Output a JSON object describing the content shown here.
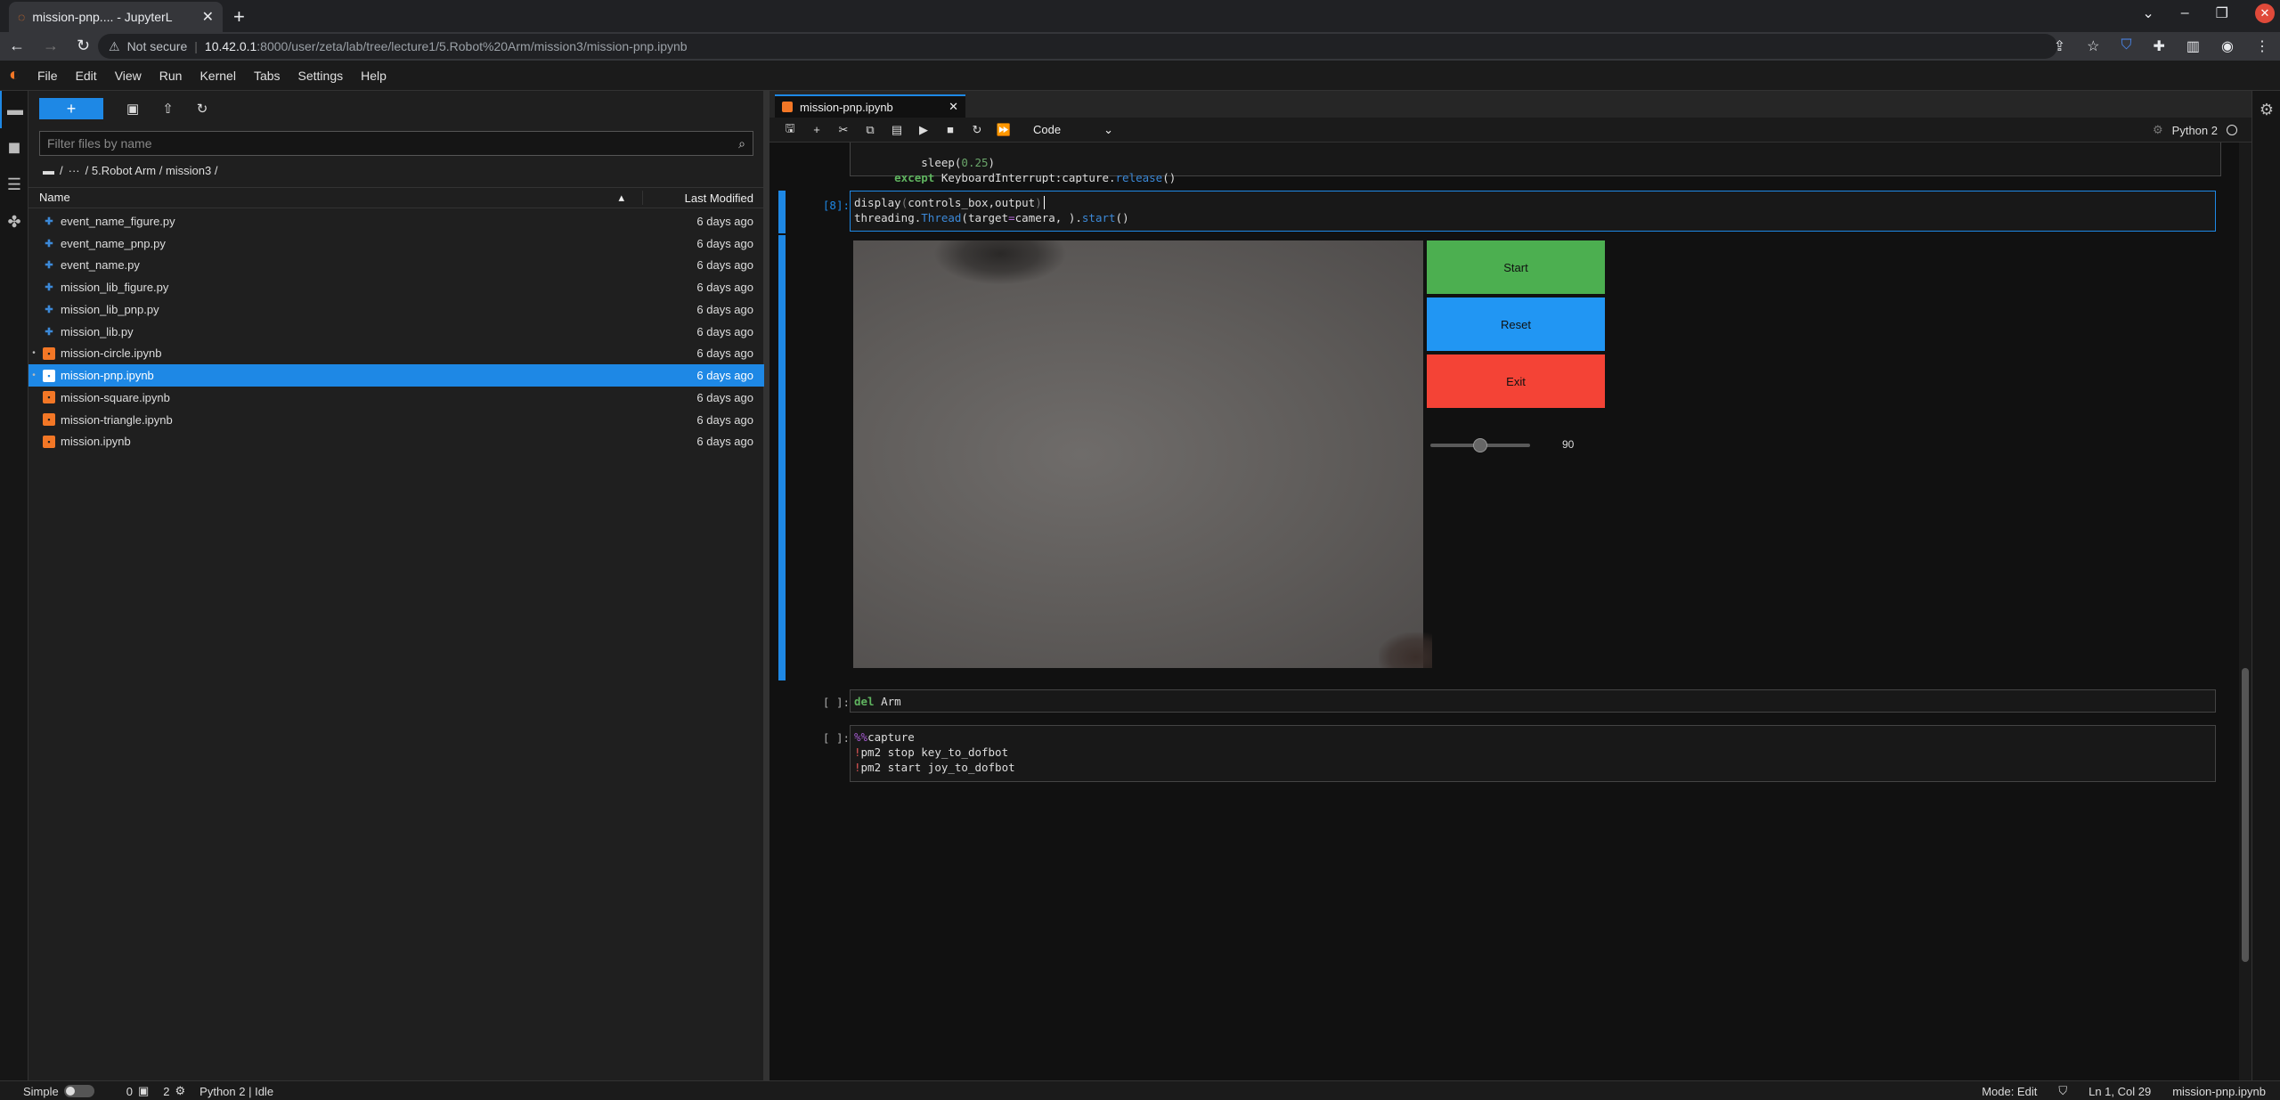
{
  "browser": {
    "tab_title": "mission-pnp.... - JupyterL",
    "url_security": "Not secure",
    "url_host": "10.42.0.1",
    "url_path": ":8000/user/zeta/lab/tree/lecture1/5.Robot%20Arm/mission3/mission-pnp.ipynb"
  },
  "menu": [
    "File",
    "Edit",
    "View",
    "Run",
    "Kernel",
    "Tabs",
    "Settings",
    "Help"
  ],
  "filebrowser": {
    "filter_placeholder": "Filter files by name",
    "breadcrumb_root": "/",
    "breadcrumb_ellipsis": "···",
    "breadcrumb_path": "/ 5.Robot Arm / mission3 /",
    "col_name": "Name",
    "col_modified": "Last Modified",
    "files": [
      {
        "name": "event_name_figure.py",
        "type": "py",
        "modified": "6 days ago",
        "running": false
      },
      {
        "name": "event_name_pnp.py",
        "type": "py",
        "modified": "6 days ago",
        "running": false
      },
      {
        "name": "event_name.py",
        "type": "py",
        "modified": "6 days ago",
        "running": false
      },
      {
        "name": "mission_lib_figure.py",
        "type": "py",
        "modified": "6 days ago",
        "running": false
      },
      {
        "name": "mission_lib_pnp.py",
        "type": "py",
        "modified": "6 days ago",
        "running": false
      },
      {
        "name": "mission_lib.py",
        "type": "py",
        "modified": "6 days ago",
        "running": false
      },
      {
        "name": "mission-circle.ipynb",
        "type": "nb",
        "modified": "6 days ago",
        "running": true
      },
      {
        "name": "mission-pnp.ipynb",
        "type": "nb",
        "modified": "6 days ago",
        "running": true,
        "selected": true
      },
      {
        "name": "mission-square.ipynb",
        "type": "nb",
        "modified": "6 days ago",
        "running": false
      },
      {
        "name": "mission-triangle.ipynb",
        "type": "nb",
        "modified": "6 days ago",
        "running": false
      },
      {
        "name": "mission.ipynb",
        "type": "nb",
        "modified": "6 days ago",
        "running": false
      }
    ]
  },
  "notebook": {
    "tab_name": "mission-pnp.ipynb",
    "cell_type": "Code",
    "kernel_name": "Python 2",
    "cells": {
      "top_line1_a": "sleep(",
      "top_line1_num": "0.25",
      "top_line1_b": ")",
      "top_line2_kw": "except",
      "top_line2_a": " KeyboardInterrupt:capture.",
      "top_line2_fn": "release",
      "top_line2_b": "()",
      "c8_prompt": "[8]:",
      "c8_l1_a": "display",
      "c8_l1_b": "(",
      "c8_l1_c": "controls_box,output",
      "c8_l1_d": ")",
      "c8_l2_a": "threading.",
      "c8_l2_fn": "Thread",
      "c8_l2_b": "(target",
      "c8_l2_op": "=",
      "c8_l2_c": "camera, ).",
      "c8_l2_fn2": "start",
      "c8_l2_d": "()",
      "del_prompt": "[ ]:",
      "del_kw": "del",
      "del_rest": " Arm",
      "cap_prompt": "[ ]:",
      "cap_l1_mg": "%%",
      "cap_l1_rest": "capture",
      "cap_l2_sh": "!",
      "cap_l2_rest": "pm2 stop key_to_dofbot",
      "cap_l3_sh": "!",
      "cap_l3_rest": "pm2 start joy_to_dofbot"
    },
    "widgets": {
      "start_label": "Start",
      "reset_label": "Reset",
      "exit_label": "Exit",
      "slider_value": "90",
      "slider_min": 0,
      "slider_max": 180
    }
  },
  "status": {
    "mode_label": "Simple",
    "terminals": "0",
    "kernels": "2",
    "kernel_status": "Python 2 | Idle",
    "mode": "Mode: Edit",
    "cursor": "Ln 1, Col 29",
    "filename": "mission-pnp.ipynb"
  },
  "colors": {
    "accent": "#1e88e5",
    "start": "#4caf50",
    "reset": "#2196f3",
    "exit": "#f44336",
    "notebook_icon": "#f37726"
  }
}
